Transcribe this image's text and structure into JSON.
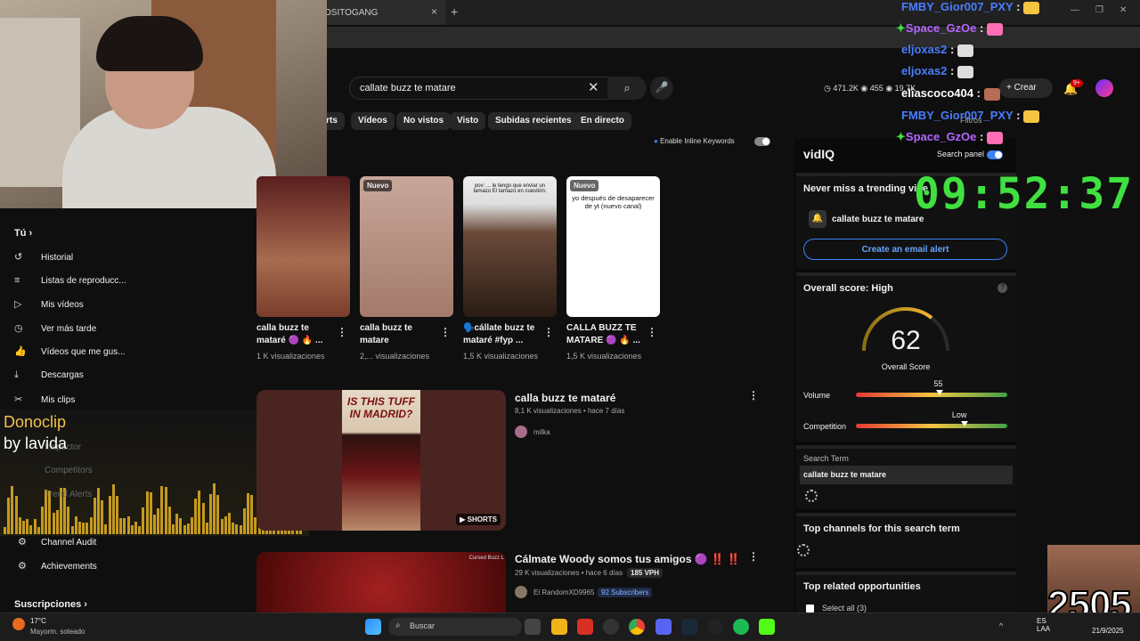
{
  "browser": {
    "tab_title": "OSITOGANG",
    "close": "×",
    "new_tab": "+",
    "window_controls": [
      "—",
      "❐",
      "✕"
    ]
  },
  "search": {
    "query": "callate buzz te matare",
    "clear": "✕",
    "search_icon": "⌕",
    "mic_icon": "🎤"
  },
  "chips": [
    "orts",
    "Vídeos",
    "No vistos",
    "Visto",
    "Subidas recientes",
    "En directo"
  ],
  "header": {
    "views": "471.2K",
    "eye": "455",
    "subs": "19.7K",
    "crear": "+ Crear",
    "notif_badge": "9+",
    "filtros": "Filtros"
  },
  "inline_keywords": {
    "label": "Enable Inline Keywords"
  },
  "sidebar": {
    "tu": "Tú",
    "items": [
      {
        "icon": "↺",
        "label": "Historial"
      },
      {
        "icon": "≡",
        "label": "Listas de reproducc..."
      },
      {
        "icon": "▷",
        "label": "Mis vídeos"
      },
      {
        "icon": "◷",
        "label": "Ver más tarde"
      },
      {
        "icon": "👍",
        "label": "Vídeos que me gus..."
      },
      {
        "icon": "⤓",
        "label": "Descargas"
      },
      {
        "icon": "✂",
        "label": "Mis clips"
      }
    ],
    "vidiq_items": [
      {
        "icon": "⚙",
        "label": "Channel Audit"
      },
      {
        "icon": "⚙",
        "label": "Achievements"
      }
    ],
    "subs": "Suscripciones"
  },
  "hidden_items": [
    "Inspector",
    "Competitors",
    "Trend Alerts"
  ],
  "clip": {
    "title": "Donoclip",
    "by": "by lavida"
  },
  "shorts": [
    {
      "new": "",
      "title": "calla buzz te mataré 🟣 🔥 ...",
      "views": "1 K visualizaciones"
    },
    {
      "new": "Nuevo",
      "title": "calla buzz te matare",
      "views": "2,... visualizaciones"
    },
    {
      "new": "",
      "title": "🗣️cállate buzz te mataré #fyp ...",
      "views": "1,5 K visualizaciones",
      "overlay": "pov: ... le tengo que enviar un tamazo\nEl tamazo en cuestión:"
    },
    {
      "new": "Nuevo",
      "title": "CALLA BUZZ TE MATARE 🟣 🔥 ...",
      "views": "1,5 K visualizaciones",
      "overlay": "yo después de desaparecer de yt (nuevo canal)"
    }
  ],
  "videos": [
    {
      "title": "calla buzz te mataré",
      "meta": "8,1 K visualizaciones • hace 7 días",
      "channel": "milka",
      "badge": "SHORTS",
      "thumb_text": "IS THIS TUFF IN MADRID?"
    },
    {
      "title": "Cálmate Woody somos tus amigos 🟣 ‼️ ‼️",
      "meta": "29 K visualizaciones • hace 6 días",
      "vph": "185 VPH",
      "channel": "El RandomXD9965",
      "subs": "92 Subscribers",
      "thumb_tag": "Cursed Buzz L"
    }
  ],
  "vidiq": {
    "logo": "vidIQ",
    "search_panel": "Search panel",
    "trending": "Never miss a trending vide",
    "alert_term": "callate buzz te matare",
    "email_btn": "Create an email alert",
    "overall": "Overall score: High",
    "score": "62",
    "score_label": "Overall Score",
    "volume": "Volume",
    "volume_val": "55",
    "competition": "Competition",
    "competition_val": "Low",
    "search_term_label": "Search Term",
    "search_term": "callate buzz te matare",
    "top_channels": "Top channels for this search term",
    "top_related": "Top related opportunities",
    "select_all": "Select all (3)",
    "volume_level": 0.55,
    "competition_level": 0.72
  },
  "clock": "09:52:37",
  "chat": [
    {
      "user": "FMBY_Gior007_PXY",
      "color": "#4a7dff",
      "emote": "#f5c542"
    },
    {
      "user": "Space_GzOe",
      "color": "#b565ff",
      "emote": "#ff6fb3",
      "badge": "✦"
    },
    {
      "user": "eljoxas2",
      "color": "#4a7dff",
      "emote": "#ddd"
    },
    {
      "user": "eljoxas2",
      "color": "#4a7dff",
      "emote": "#ddd"
    },
    {
      "user": "eliascoco404",
      "color": "#ffffff",
      "emote": "#b86b55"
    },
    {
      "user": "FMBY_Gior007_PXY",
      "color": "#4a7dff",
      "emote": "#f5c542"
    },
    {
      "user": "Space_GzOe",
      "color": "#b565ff",
      "emote": "#ff6fb3",
      "badge": "✦"
    }
  ],
  "counter": "2505",
  "taskbar": {
    "temp": "17°C",
    "weather": "Mayorm. soleado",
    "search": "Buscar",
    "lang1": "ES",
    "lang2": "LAA",
    "time": "",
    "date": "21/9/2025"
  }
}
